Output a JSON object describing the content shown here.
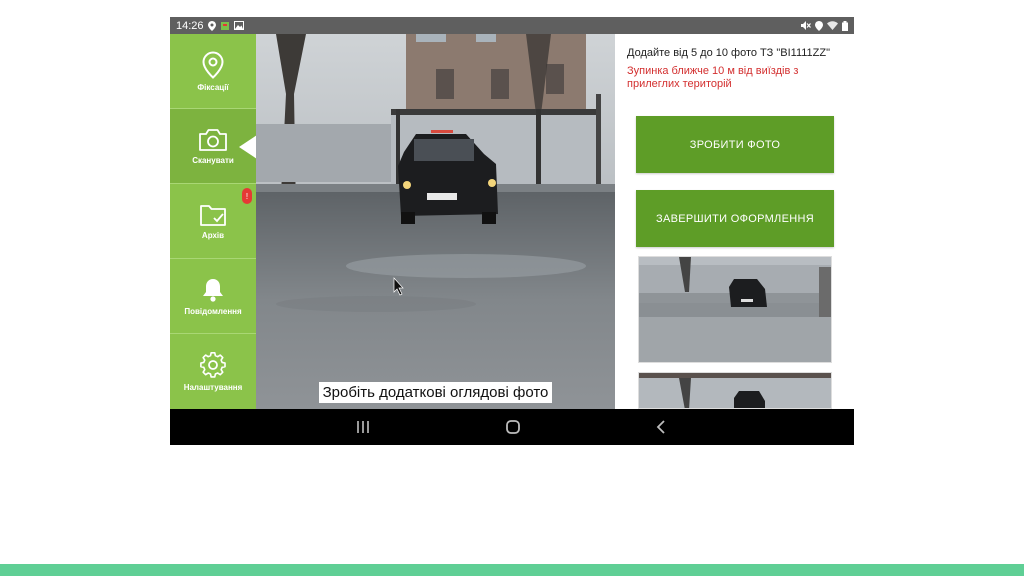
{
  "status_bar": {
    "time": "14:26",
    "left_icons": [
      "location-icon",
      "app-notification-icon",
      "image-icon"
    ],
    "right_icons": [
      "mute-icon",
      "location-icon",
      "wifi-icon",
      "battery-icon"
    ]
  },
  "sidebar": {
    "items": [
      {
        "label": "Фіксації",
        "icon": "map-pin-icon"
      },
      {
        "label": "Сканувати",
        "icon": "camera-icon",
        "active": true
      },
      {
        "label": "Архів",
        "icon": "folder-check-icon",
        "badge": "!"
      },
      {
        "label": "Повідомлення",
        "icon": "bell-icon"
      },
      {
        "label": "Налаштування",
        "icon": "gear-icon"
      }
    ]
  },
  "camera": {
    "caption": "Зробіть додаткові оглядові фото"
  },
  "panel": {
    "title": "Додайте від 5 до 10 фото ТЗ \"ВІ1111ZZ\"",
    "warning": "Зупинка ближче 10 м від виїздів з прилеглих територій",
    "take_photo_label": "ЗРОБИТИ ФОТО",
    "finish_label": "ЗАВЕРШИТИ ОФОРМЛЕННЯ"
  },
  "navbar": {
    "buttons": [
      "recents-icon",
      "home-icon",
      "back-icon"
    ]
  },
  "colors": {
    "sidebar": "#8bc34a",
    "button": "#5e9d27",
    "warning": "#d32f2f",
    "strip": "#5fcf95"
  }
}
